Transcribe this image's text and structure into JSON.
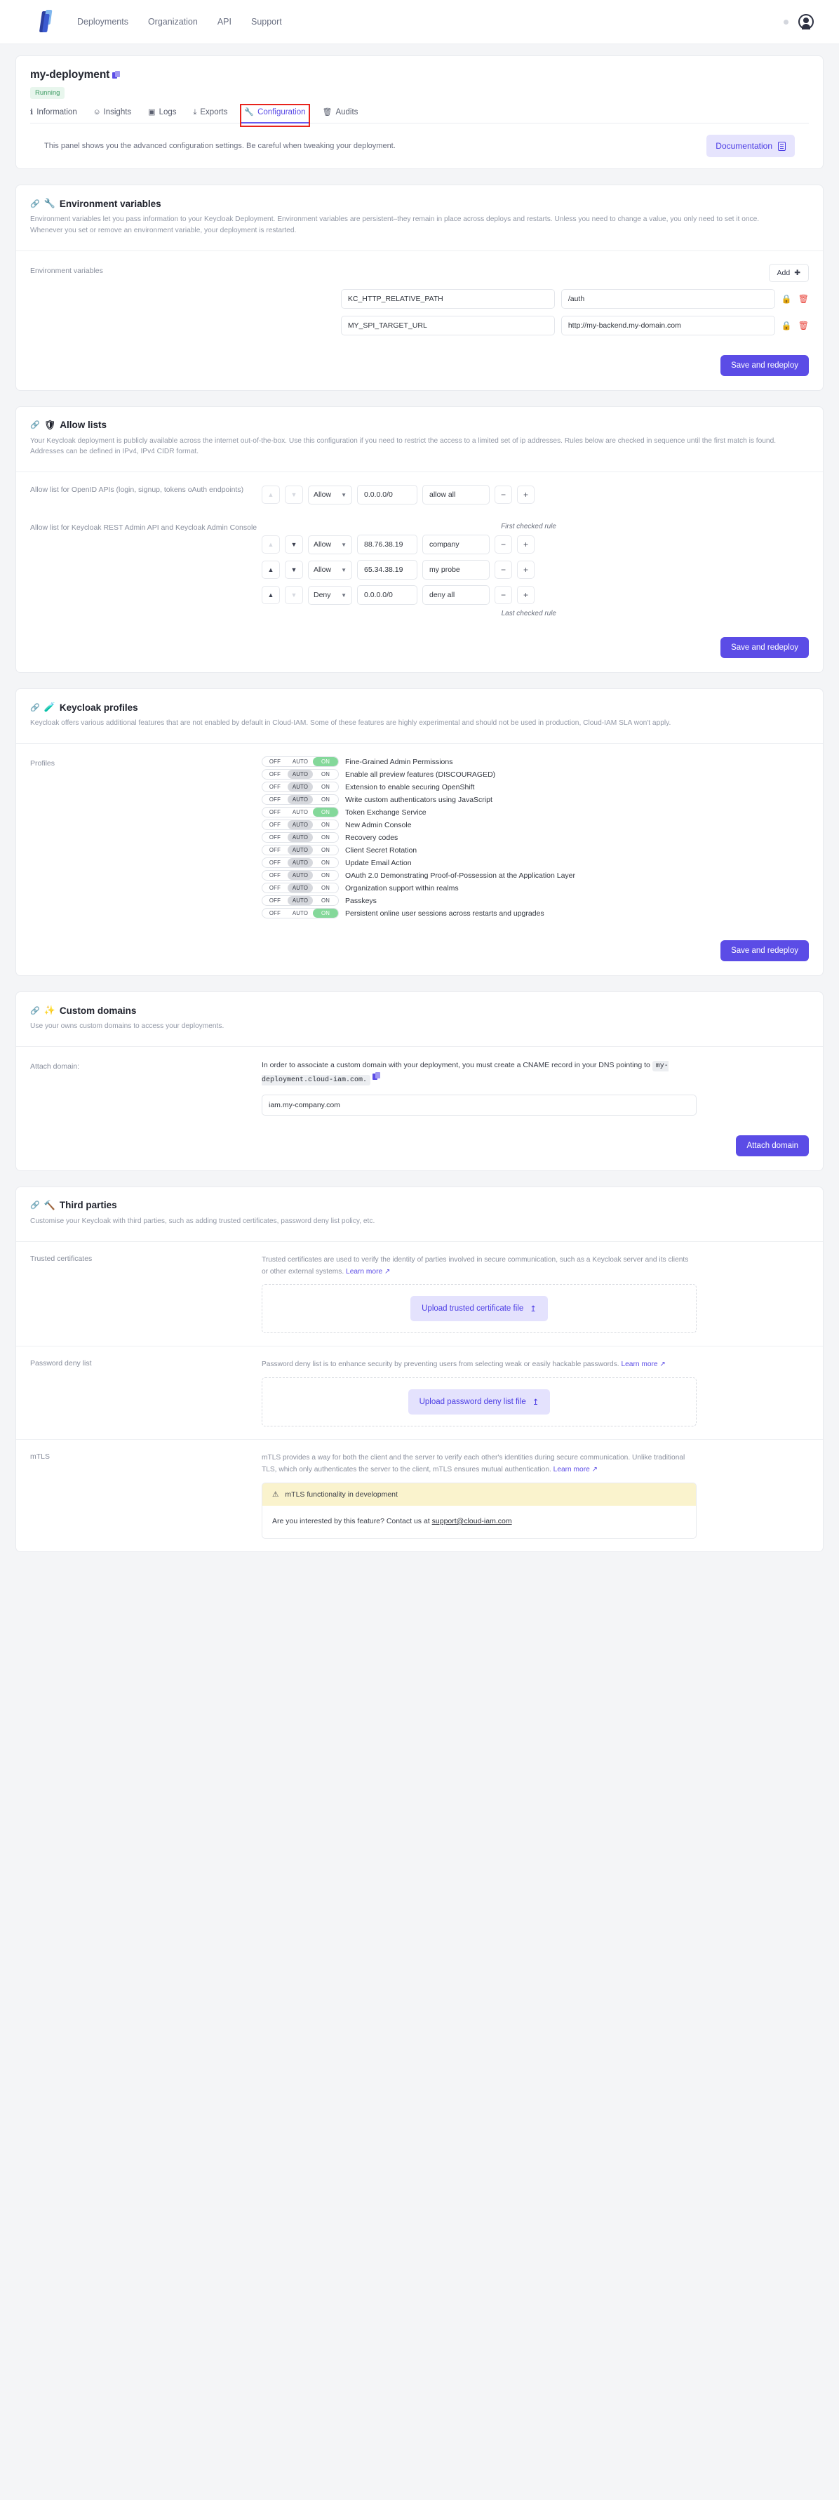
{
  "topnav": {
    "logo_name": "cloud-iam-logo",
    "links": [
      "Deployments",
      "Organization",
      "API",
      "Support"
    ]
  },
  "header": {
    "deployment_name": "my-deployment",
    "status_badge": "Running",
    "tabs": [
      {
        "label": "Information",
        "icon": "i"
      },
      {
        "label": "Insights",
        "icon": "↗"
      },
      {
        "label": "Logs",
        "icon": "☷"
      },
      {
        "label": "Exports",
        "icon": "⤓"
      },
      {
        "label": "Configuration",
        "icon": "🔧"
      },
      {
        "label": "Audits",
        "icon": "🗑"
      }
    ],
    "active_tab": "Configuration",
    "panel_note": "This panel shows you the advanced configuration settings. Be careful when tweaking your deployment.",
    "documentation_button": "Documentation"
  },
  "env": {
    "title": "Environment variables",
    "emoji": "🔧",
    "description": "Environment variables let you pass information to your Keycloak Deployment. Environment variables are persistent–they remain in place across deploys and restarts. Unless you need to change a value, you only need to set it once. Whenever you set or remove an environment variable, your deployment is restarted.",
    "row_label": "Environment variables",
    "add_label": "Add",
    "rows": [
      {
        "key": "KC_HTTP_RELATIVE_PATH",
        "value": "/auth"
      },
      {
        "key": "MY_SPI_TARGET_URL",
        "value": "http://my-backend.my-domain.com"
      }
    ],
    "save_label": "Save and redeploy"
  },
  "allow": {
    "title": "Allow lists",
    "emoji": "🛡",
    "description": "Your Keycloak deployment is publicly available across the internet out-of-the-box. Use this configuration if you need to restrict the access to a limited set of ip addresses. Rules below are checked in sequence until the first match is found. Addresses can be defined in IPv4, IPv4 CIDR format.",
    "blocks": [
      {
        "label": "Allow list for OpenID APIs (login, signup, tokens oAuth endpoints)",
        "note_top": "",
        "note_bottom": "",
        "rules": [
          {
            "action": "Allow",
            "address": "0.0.0.0/0",
            "description": "allow all",
            "up_dim": true,
            "down_dim": true
          }
        ]
      },
      {
        "label": "Allow list for Keycloak REST Admin API and Keycloak Admin Console",
        "note_top": "First checked rule",
        "note_bottom": "Last checked rule",
        "rules": [
          {
            "action": "Allow",
            "address": "88.76.38.19",
            "description": "company",
            "up_dim": true,
            "down_dim": false
          },
          {
            "action": "Allow",
            "address": "65.34.38.19",
            "description": "my probe",
            "up_dim": false,
            "down_dim": false
          },
          {
            "action": "Deny",
            "address": "0.0.0.0/0",
            "description": "deny all",
            "up_dim": false,
            "down_dim": true
          }
        ]
      }
    ],
    "save_label": "Save and redeploy"
  },
  "profiles": {
    "title": "Keycloak profiles",
    "emoji": "🧪",
    "description": "Keycloak offers various additional features that are not enabled by default in Cloud-IAM. Some of these features are highly experimental and should not be used in production, Cloud-IAM SLA won't apply.",
    "row_label": "Profiles",
    "options": [
      "OFF",
      "AUTO",
      "ON"
    ],
    "items": [
      {
        "label": "Fine-Grained Admin Permissions",
        "state": "ON"
      },
      {
        "label": "Enable all preview features (DISCOURAGED)",
        "state": "AUTO"
      },
      {
        "label": "Extension to enable securing OpenShift",
        "state": "AUTO"
      },
      {
        "label": "Write custom authenticators using JavaScript",
        "state": "AUTO"
      },
      {
        "label": "Token Exchange Service",
        "state": "ON"
      },
      {
        "label": "New Admin Console",
        "state": "AUTO"
      },
      {
        "label": "Recovery codes",
        "state": "AUTO"
      },
      {
        "label": "Client Secret Rotation",
        "state": "AUTO"
      },
      {
        "label": "Update Email Action",
        "state": "AUTO"
      },
      {
        "label": "OAuth 2.0 Demonstrating Proof-of-Possession at the Application Layer",
        "state": "AUTO"
      },
      {
        "label": "Organization support within realms",
        "state": "AUTO"
      },
      {
        "label": "Passkeys",
        "state": "AUTO"
      },
      {
        "label": "Persistent online user sessions across restarts and upgrades",
        "state": "ON"
      }
    ],
    "save_label": "Save and redeploy"
  },
  "domains": {
    "title": "Custom domains",
    "emoji": "✨",
    "description": "Use your owns custom domains to access your deployments.",
    "row_label": "Attach domain:",
    "instruction_prefix": "In order to associate a custom domain with your deployment, you must create a CNAME record in your DNS pointing to",
    "cname_value": "my-deployment.cloud-iam.com.",
    "domain_value": "iam.my-company.com",
    "attach_label": "Attach domain"
  },
  "third_parties": {
    "title": "Third parties",
    "emoji": "🔨",
    "description": "Customise your Keycloak with third parties, such as adding trusted certificates, password deny list policy, etc.",
    "blocks": [
      {
        "label": "Trusted certificates",
        "desc": "Trusted certificates are used to verify the identity of parties involved in secure communication, such as a Keycloak server and its clients or other external systems.",
        "learn_more": "Learn more",
        "upload_label": "Upload trusted certificate file"
      },
      {
        "label": "Password deny list",
        "desc": "Password deny list is to enhance security by preventing users from selecting weak or easily hackable passwords.",
        "learn_more": "Learn more",
        "upload_label": "Upload password deny list file"
      }
    ],
    "mtls": {
      "label": "mTLS",
      "desc": "mTLS provides a way for both the client and the server to verify each other's identities during secure communication. Unlike traditional TLS, which only authenticates the server to the client, mTLS ensures mutual authentication.",
      "learn_more": "Learn more",
      "warning": "mTLS functionality in development",
      "contact_prefix": "Are you interested by this feature? Contact us at",
      "contact_email": "support@cloud-iam.com"
    }
  },
  "colors": {
    "accent": "#5b4ce6",
    "accent_light": "#e4e2fd",
    "running": "#3d9b63",
    "danger": "#e8433a",
    "toggle_on": "#84d89a",
    "warning_bg": "#faf3cd"
  }
}
